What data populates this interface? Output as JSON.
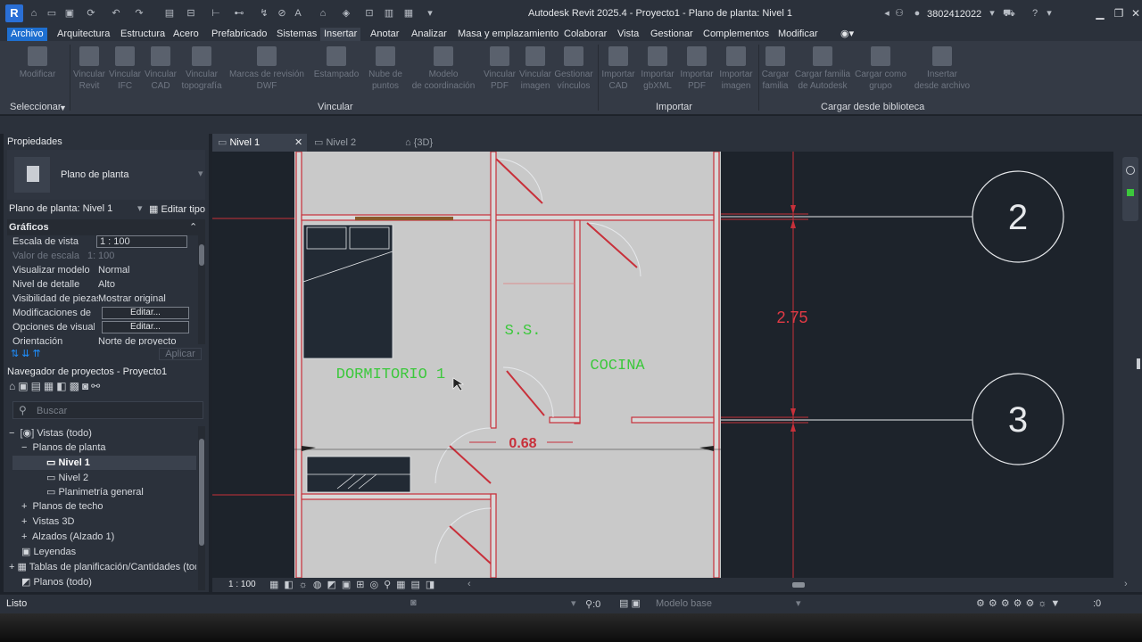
{
  "titlebar": {
    "logo": "R",
    "title": "Autodesk Revit 2025.4 - Proyecto1 - Plano de planta: Nivel 1",
    "user_id": "3802412022"
  },
  "menu": [
    "Archivo",
    "Arquitectura",
    "Estructura",
    "Acero",
    "Prefabricado",
    "Sistemas",
    "Insertar",
    "Anotar",
    "Analizar",
    "Masa y emplazamiento",
    "Colaborar",
    "Vista",
    "Gestionar",
    "Complementos",
    "Modificar"
  ],
  "ribbon": {
    "tools": [
      {
        "label": "Modificar"
      },
      {
        "label": "Vincular\nRevit"
      },
      {
        "label": "Vincular\nIFC"
      },
      {
        "label": "Vincular\nCAD"
      },
      {
        "label": "Vincular\ntopografía"
      },
      {
        "label": "Marcas de revisión\nDWF"
      },
      {
        "label": "Estampado"
      },
      {
        "label": "Nube de\npuntos"
      },
      {
        "label": "Modelo\nde coordinación"
      },
      {
        "label": "Vincular\nPDF"
      },
      {
        "label": "Vincular\nimagen"
      },
      {
        "label": "Gestionar\nvínculos"
      },
      {
        "label": "Importar\nCAD"
      },
      {
        "label": "Importar\ngbXML"
      },
      {
        "label": "Importar\nPDF"
      },
      {
        "label": "Importar\nimagen"
      },
      {
        "label": "Cargar\nfamilia"
      },
      {
        "label": "Cargar familia\nde Autodesk"
      },
      {
        "label": "Cargar como\ngrupo"
      },
      {
        "label": "Insertar\ndesde archivo"
      }
    ],
    "panels": {
      "select": "Seleccionar",
      "link": "Vincular",
      "import": "Importar",
      "library": "Cargar desde biblioteca"
    }
  },
  "properties": {
    "header": "Propiedades",
    "type_name": "Plano de planta",
    "selector": "Plano de planta: Nivel 1",
    "edit_type": "Editar tipo",
    "section": "Gráficos",
    "rows": [
      {
        "k": "Escala de vista",
        "v": "1 : 100"
      },
      {
        "k": "Valor de escala",
        "v": "100",
        "pre": "1:"
      },
      {
        "k": "Visualizar modelo",
        "v": "Normal"
      },
      {
        "k": "Nivel de detalle",
        "v": "Alto"
      },
      {
        "k": "Visibilidad de piezas",
        "v": "Mostrar original"
      },
      {
        "k": "Modificaciones de ...",
        "v": "Editar..."
      },
      {
        "k": "Opciones de visuali...",
        "v": "Editar..."
      },
      {
        "k": "Orientación",
        "v": "Norte de proyecto"
      }
    ],
    "apply": "Aplicar"
  },
  "browser": {
    "header": "Navegador de proyectos - Proyecto1",
    "search_placeholder": "Buscar",
    "items": [
      "Vistas (todo)",
      "Planos de planta",
      "Nivel 1",
      "Nivel 2",
      "Planimetría general",
      "Planos de techo",
      "Vistas 3D",
      "Alzados (Alzado 1)",
      "Leyendas",
      "Tablas de planificación/Cantidades (todo)",
      "Planos (todo)"
    ]
  },
  "tabs": [
    "Nivel 1",
    "Nivel 2",
    "{3D}"
  ],
  "drawing": {
    "rooms": [
      "DORMITORIO 1",
      "S.S.",
      "COCINA"
    ],
    "grid_labels": [
      "2",
      "3"
    ],
    "dimensions": [
      "2.75",
      "0.68"
    ]
  },
  "viewbar": {
    "scale": "1 : 100"
  },
  "status": {
    "left": "Listo",
    "filter": ":0",
    "model": "Modelo base",
    "sel": ":0"
  },
  "colors": {
    "accent": "#1e6fd0",
    "wall_red": "#c8303a",
    "room_green": "#3cc83c",
    "dim_red": "#e23a45"
  }
}
